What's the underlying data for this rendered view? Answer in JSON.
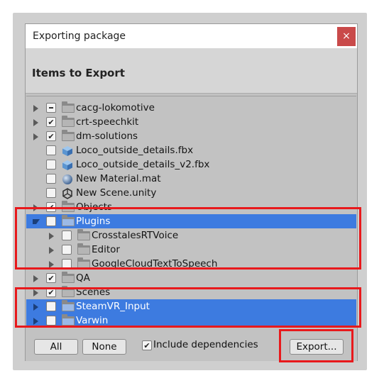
{
  "window": {
    "title": "Exporting package",
    "close_label": "×",
    "header": "Items to Export"
  },
  "tree": {
    "items": [
      {
        "label": "cacg-lokomotive",
        "state": "mixed",
        "type": "folder",
        "expandable": true,
        "expanded": false,
        "selected": false,
        "depth": 0
      },
      {
        "label": "crt-speechkit",
        "state": "checked",
        "type": "folder",
        "expandable": true,
        "expanded": false,
        "selected": false,
        "depth": 0
      },
      {
        "label": "dm-solutions",
        "state": "checked",
        "type": "folder",
        "expandable": true,
        "expanded": false,
        "selected": false,
        "depth": 0
      },
      {
        "label": "Loco_outside_details.fbx",
        "state": "unchecked",
        "type": "model",
        "expandable": false,
        "selected": false,
        "depth": 0
      },
      {
        "label": "Loco_outside_details_v2.fbx",
        "state": "unchecked",
        "type": "model",
        "expandable": false,
        "selected": false,
        "depth": 0
      },
      {
        "label": "New Material.mat",
        "state": "unchecked",
        "type": "material",
        "expandable": false,
        "selected": false,
        "depth": 0
      },
      {
        "label": "New Scene.unity",
        "state": "unchecked",
        "type": "scene",
        "expandable": false,
        "selected": false,
        "depth": 0
      },
      {
        "label": "Objects",
        "state": "checked",
        "type": "folder",
        "expandable": true,
        "expanded": false,
        "selected": false,
        "depth": 0
      },
      {
        "label": "Plugins",
        "state": "unchecked",
        "type": "folder",
        "expandable": true,
        "expanded": true,
        "selected": true,
        "depth": 0
      },
      {
        "label": "CrosstalesRTVoice",
        "state": "unchecked",
        "type": "folder",
        "expandable": true,
        "expanded": false,
        "selected": false,
        "depth": 1
      },
      {
        "label": "Editor",
        "state": "unchecked",
        "type": "folder",
        "expandable": true,
        "expanded": false,
        "selected": false,
        "depth": 1
      },
      {
        "label": "GoogleCloudTextToSpeech",
        "state": "unchecked",
        "type": "folder",
        "expandable": true,
        "expanded": false,
        "selected": false,
        "depth": 1
      },
      {
        "label": "QA",
        "state": "checked",
        "type": "folder",
        "expandable": true,
        "expanded": false,
        "selected": false,
        "depth": 0
      },
      {
        "label": "Scenes",
        "state": "checked",
        "type": "folder",
        "expandable": true,
        "expanded": false,
        "selected": false,
        "depth": 0
      },
      {
        "label": "SteamVR_Input",
        "state": "unchecked",
        "type": "folder",
        "expandable": true,
        "expanded": false,
        "selected": true,
        "depth": 0
      },
      {
        "label": "Varwin",
        "state": "unchecked",
        "type": "folder",
        "expandable": true,
        "expanded": false,
        "selected": true,
        "depth": 0
      }
    ]
  },
  "footer": {
    "all_label": "All",
    "none_label": "None",
    "include_dependencies_label": "Include dependencies",
    "include_dependencies_checked": true,
    "export_label": "Export..."
  },
  "colors": {
    "selection": "#3d7be0",
    "highlight_box": "#e8191c",
    "close_button": "#c94a4a"
  }
}
